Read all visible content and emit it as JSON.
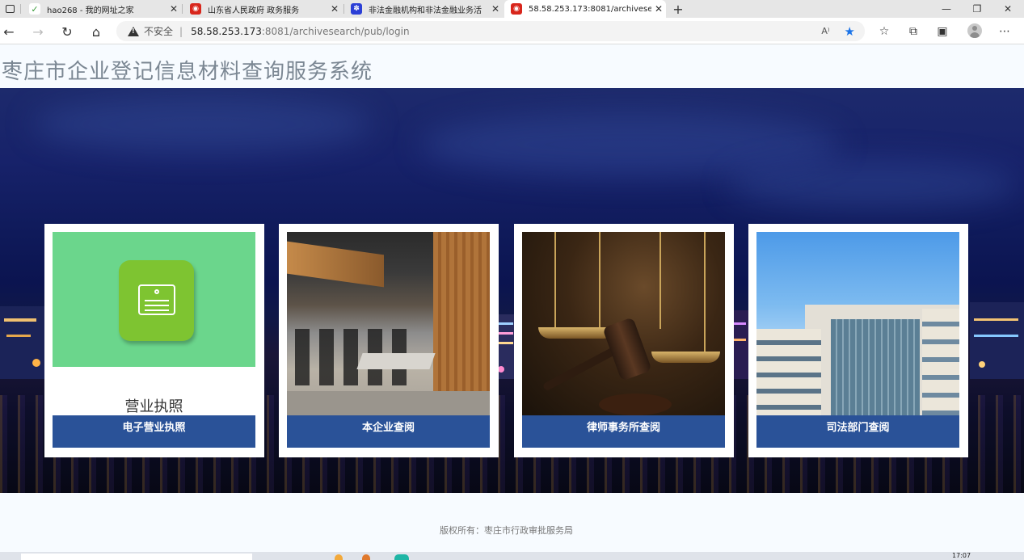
{
  "browser": {
    "tabs": [
      {
        "title": "hao268 - 我的网址之家",
        "favicon": "hao268-icon",
        "active": false
      },
      {
        "title": "山东省人民政府 政务服务",
        "favicon": "gov-emblem-icon",
        "active": false
      },
      {
        "title": "非法金融机构和非法金融业务活",
        "favicon": "baidu-paw-icon",
        "active": false
      },
      {
        "title": "58.58.253.173:8081/archivesearc",
        "favicon": "gov-emblem-icon",
        "active": true
      }
    ],
    "new_tab_symbol": "+",
    "close_symbol": "✕",
    "window_controls": [
      "—",
      "❐",
      "✕"
    ],
    "address": {
      "security_label": "不安全",
      "separator": "|",
      "host": "58.58.253.173",
      "path": ":8081/archivesearch/pub/login",
      "read_aloud": "A⁾"
    }
  },
  "page": {
    "title": "枣庄市企业登记信息材料查询服务系统",
    "cards": [
      {
        "label": "电子营业执照",
        "image": "business-license-icon",
        "caption": "营业执照"
      },
      {
        "label": "本企业查阅",
        "image": "office-interior-photo"
      },
      {
        "label": "律师事务所查阅",
        "image": "scales-and-gavel-photo"
      },
      {
        "label": "司法部门查阅",
        "image": "government-building-photo"
      }
    ],
    "footer": "版权所有：枣庄市行政审批服务局"
  },
  "taskbar": {
    "clock": "17:07"
  },
  "colors": {
    "band": "#2a5298",
    "license_green": "#6bd68c",
    "license_tile": "#7ec431",
    "star": "#1a73e8",
    "title_grey": "#7b8793"
  }
}
